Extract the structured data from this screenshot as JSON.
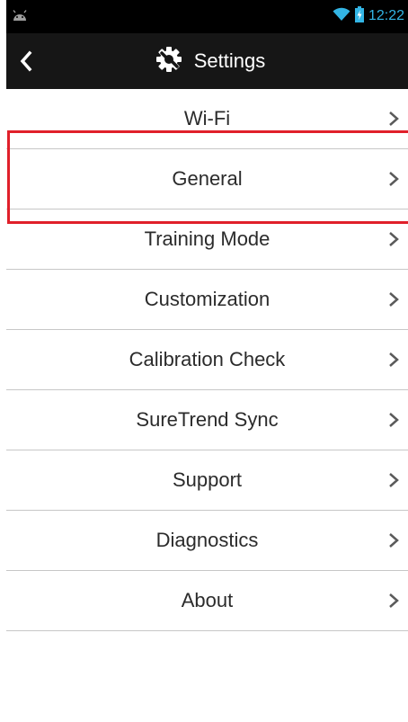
{
  "status_bar": {
    "time": "12:22",
    "icons": [
      "android-icon",
      "wifi-icon",
      "battery-charging-icon"
    ]
  },
  "header": {
    "title": "Settings",
    "back_icon": "back-chevron-icon",
    "title_icon": "settings-gear-icon"
  },
  "menu": {
    "items": [
      {
        "label": "Wi-Fi"
      },
      {
        "label": "General"
      },
      {
        "label": "Training Mode"
      },
      {
        "label": "Customization"
      },
      {
        "label": "Calibration Check"
      },
      {
        "label": "SureTrend Sync"
      },
      {
        "label": "Support"
      },
      {
        "label": "Diagnostics"
      },
      {
        "label": "About"
      }
    ],
    "highlighted_item": "General"
  },
  "colors": {
    "status_bar_bg": "#000000",
    "app_bar_bg": "#161616",
    "accent": "#33b5e5",
    "highlight": "#e0202a",
    "divider": "#c7c7c7"
  }
}
